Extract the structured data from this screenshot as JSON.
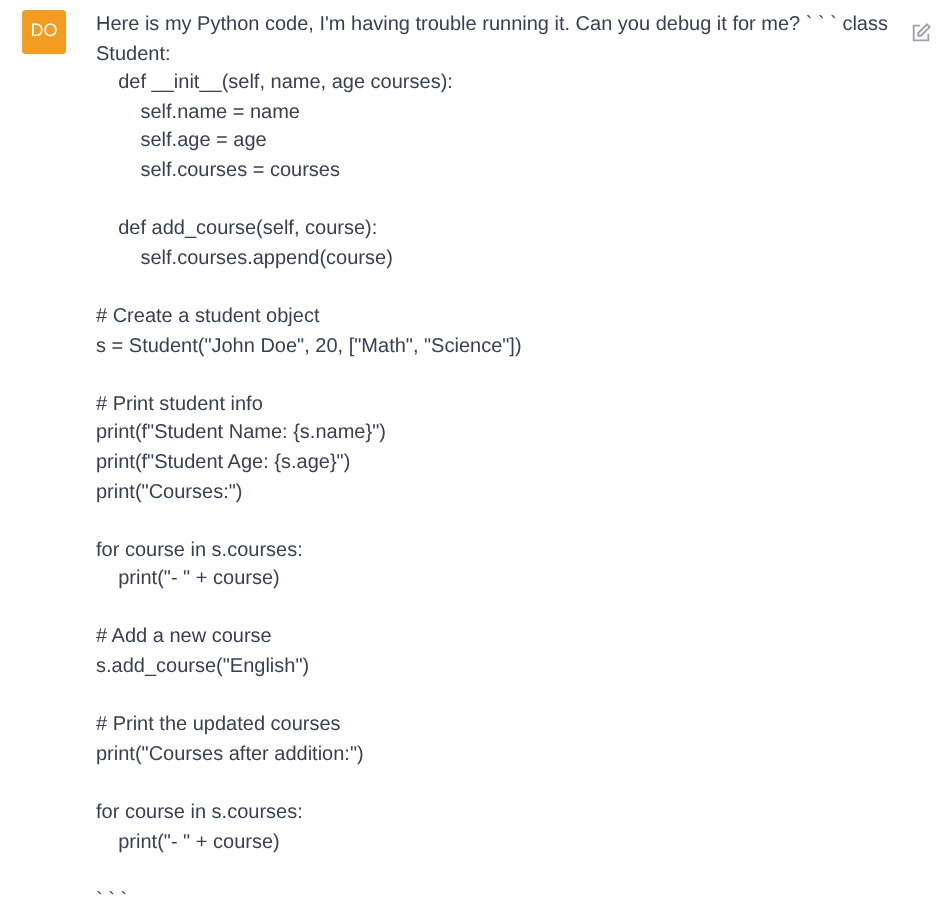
{
  "avatar": {
    "initials": "DO"
  },
  "message": {
    "blocks": [
      [
        "Here is my Python code, I'm having trouble running it. Can you debug it for me? ` ` ` class",
        "Student:",
        "    def __init__(self, name, age courses):",
        "        self.name = name",
        "        self.age = age",
        "        self.courses = courses"
      ],
      [
        "    def add_course(self, course):",
        "        self.courses.append(course)"
      ],
      [
        "# Create a student object",
        "s = Student(\"John Doe\", 20, [\"Math\", \"Science\"])"
      ],
      [
        "# Print student info",
        "print(f\"Student Name: {s.name}\")",
        "print(f\"Student Age: {s.age}\")",
        "print(\"Courses:\")"
      ],
      [
        "for course in s.courses:",
        "    print(\"- \" + course)"
      ],
      [
        "# Add a new course",
        "s.add_course(\"English\")"
      ],
      [
        "# Print the updated courses",
        "print(\"Courses after addition:\")"
      ],
      [
        "for course in s.courses:",
        "    print(\"- \" + course)"
      ],
      [
        "` ` `"
      ]
    ]
  }
}
